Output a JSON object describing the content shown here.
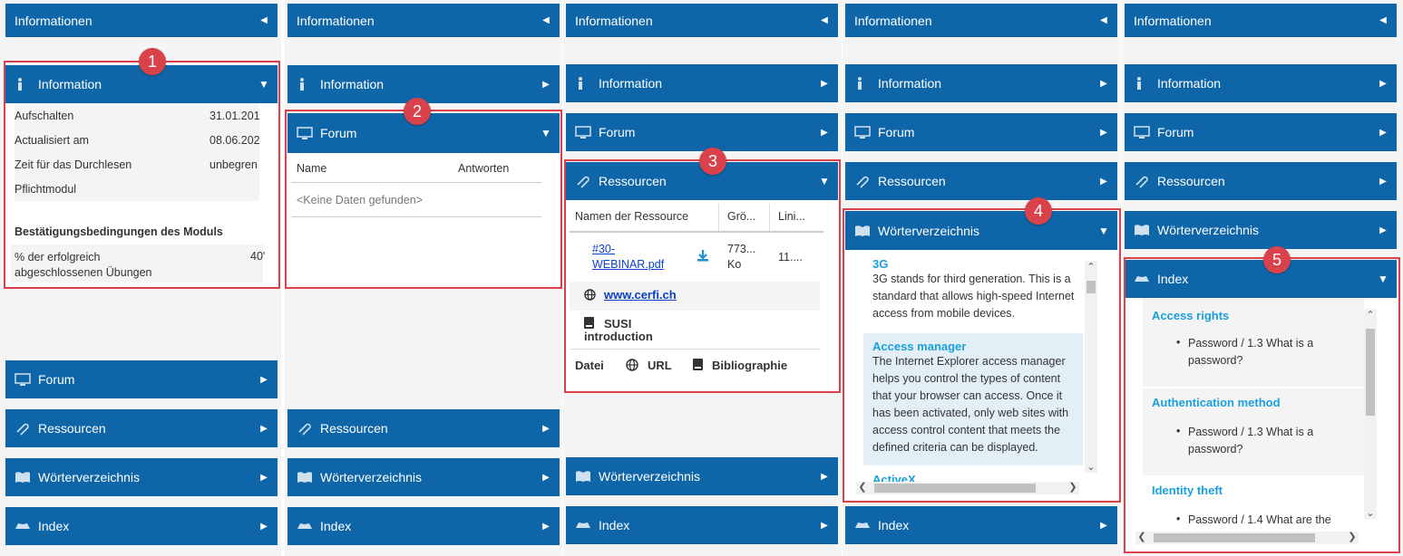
{
  "header_title": "Informationen",
  "sections": {
    "information": "Information",
    "forum": "Forum",
    "ressourcen": "Ressourcen",
    "woerterverzeichnis": "Wörterverzeichnis",
    "index": "Index"
  },
  "badges": [
    "1",
    "2",
    "3",
    "4",
    "5"
  ],
  "information_panel": {
    "rows": [
      {
        "key": "Aufschalten",
        "value": "31.01.201"
      },
      {
        "key": "Actualisiert am",
        "value": "08.06.202"
      },
      {
        "key": "Zeit für das Durchlesen",
        "value": "unbegren"
      },
      {
        "key": "Pflichtmodul",
        "value": ""
      }
    ],
    "conditions_title": "Bestätigungsbedingungen des Moduls",
    "condition_key": "% der erfolgreich abgeschlossenen Übungen",
    "condition_value": "40'"
  },
  "forum_panel": {
    "col_name": "Name",
    "col_answers": "Antworten",
    "empty": "<Keine Daten gefunden>"
  },
  "ressourcen_panel": {
    "col_name": "Namen der Ressource",
    "col_size": "Grö...",
    "col_link": "Lini...",
    "file_link": "#30-WEBINAR.pdf",
    "file_size": "773... Ko",
    "file_date": "11....",
    "url": "www.cerfi.ch",
    "biblio": "SUSI introduction",
    "filter_file": "Datei",
    "filter_url": "URL",
    "filter_biblio": "Bibliographie"
  },
  "glossary_panel": {
    "entries": [
      {
        "term": "3G",
        "definition": "3G stands for third generation. This is a standard that allows high-speed Internet access from mobile devices."
      },
      {
        "term": "Access manager",
        "definition": "The Internet Explorer access manager helps you control the types of content that your browser can access. Once it has been activated, only web sites with access control content that meets the defined criteria can be displayed."
      },
      {
        "term": "ActiveX",
        "definition": ""
      }
    ]
  },
  "index_panel": {
    "entries": [
      {
        "term": "Access rights",
        "item": "Password / 1.3 What is a password?"
      },
      {
        "term": "Authentication method",
        "item": "Password / 1.3 What is a password?"
      },
      {
        "term": "Identity theft",
        "item": "Password / 1.4 What are the"
      }
    ]
  },
  "colors": {
    "bar": "#0e66a8",
    "highlight": "#d9414b",
    "term": "#1aa0dc"
  }
}
